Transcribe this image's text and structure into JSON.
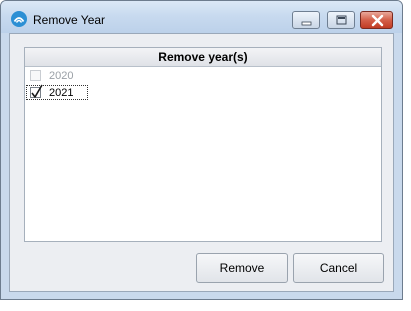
{
  "window": {
    "title": "Remove Year",
    "app_icon": "app-logo-icon"
  },
  "title_controls": {
    "minimize_icon": "minimize-icon",
    "maximize_icon": "maximize-icon",
    "close_icon": "close-icon"
  },
  "list": {
    "header": "Remove year(s)",
    "items": [
      {
        "label": "2020",
        "checked": false,
        "enabled": false
      },
      {
        "label": "2021",
        "checked": true,
        "enabled": true
      }
    ]
  },
  "buttons": {
    "remove_label": "Remove",
    "cancel_label": "Cancel"
  },
  "colors": {
    "app_icon": "#2b8fd4",
    "close_button": "#c13c24",
    "titlebar": "#c8daef"
  }
}
